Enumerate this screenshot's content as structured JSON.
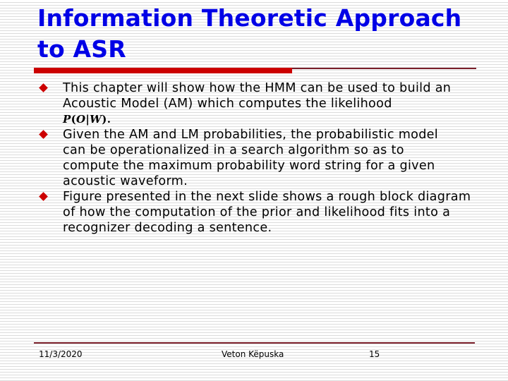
{
  "slide": {
    "title_line1": "Information Theoretic Approach",
    "title_line2": "to ASR",
    "bullets": [
      {
        "icon": "red-diamond-bullet",
        "text": "This chapter will show how the HMM can be used to build an Acoustic Model (AM) which computes the likelihood",
        "formula": "P(O|W)."
      },
      {
        "icon": "red-diamond-bullet",
        "text": "Given the AM and LM probabilities, the probabilistic model can be operationalized in a search algorithm so as to compute the maximum probability word string for a given acoustic waveform."
      },
      {
        "icon": "red-diamond-bullet",
        "text": "Figure presented in the next slide shows a rough block diagram of how the computation of the prior and likelihood fits into a recognizer decoding a sentence."
      }
    ]
  },
  "footer": {
    "date": "11/3/2020",
    "author": "Veton Këpuska",
    "page_number": "15"
  },
  "colors": {
    "title": "#0000e6",
    "accent": "#cc0000",
    "rule": "#7a1f2a"
  }
}
